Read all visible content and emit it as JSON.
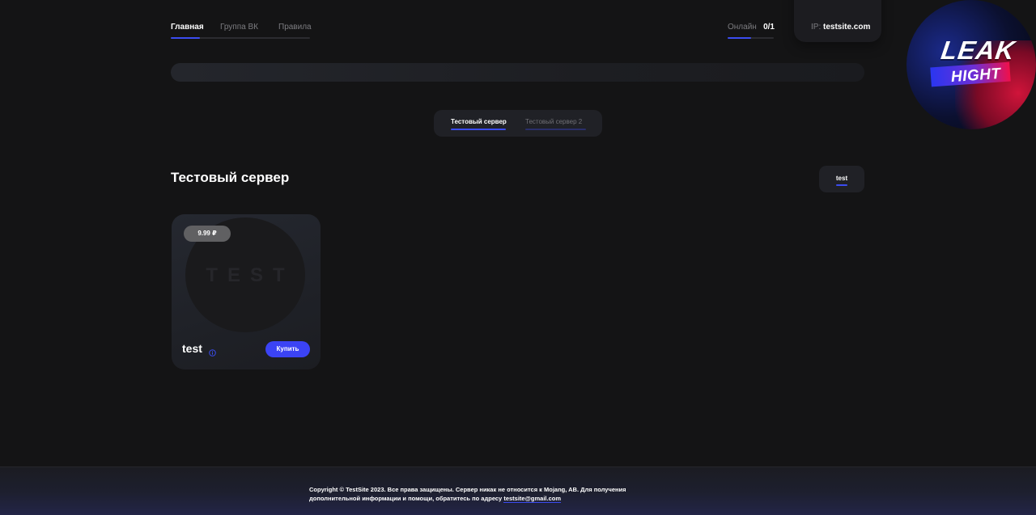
{
  "nav": {
    "items": [
      {
        "label": "Главная",
        "active": true
      },
      {
        "label": "Группа ВК",
        "active": false
      },
      {
        "label": "Правила",
        "active": false
      }
    ]
  },
  "status": {
    "online_label": "Онлайн",
    "online_count": "0/1",
    "online_fraction": 0.5,
    "ip_label": "IP:",
    "ip_value": "testsite.com"
  },
  "logo": {
    "line1": "LEAK",
    "line2": "HIGHT"
  },
  "server_tabs": [
    {
      "label": "Тестовый сервер",
      "active": true
    },
    {
      "label": "Тестовый сервер 2",
      "active": false
    }
  ],
  "section": {
    "title": "Тестовый сервер",
    "category": "test"
  },
  "products": [
    {
      "price": "9.99 ₽",
      "image_text": "TEST",
      "name": "test",
      "buy_label": "Купить"
    }
  ],
  "footer": {
    "text": "Copyright © TestSite 2023. Все права защищены. Сервер никак не относится к Mojang, AB. Для получения дополнительной информации и помощи, обратитесь по адресу",
    "email": "testsite@gmail.com"
  },
  "colors": {
    "background": "#141415",
    "accent": "#3b4cf0",
    "button": "#3b43f5",
    "panel": "#202126"
  },
  "icons": {
    "info": "info-circle-icon"
  }
}
